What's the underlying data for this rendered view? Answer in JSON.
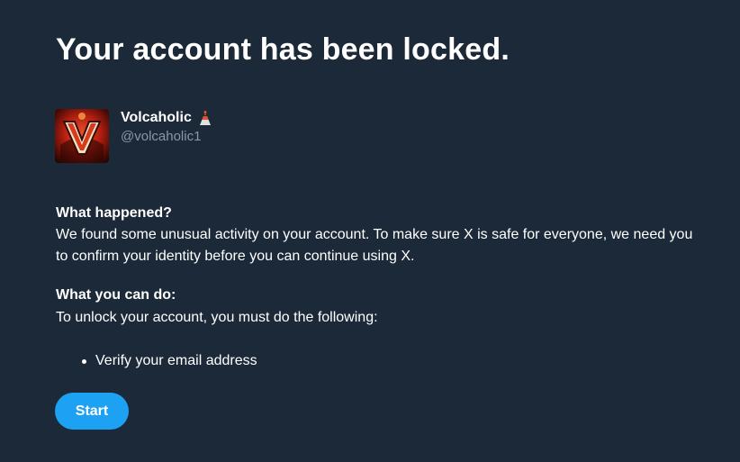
{
  "page": {
    "title": "Your account has been locked."
  },
  "profile": {
    "display_name": "Volcaholic",
    "name_emoji_icon": "volcano-icon",
    "handle": "@volcaholic1",
    "avatar_icon": "volcano-v-logo"
  },
  "what_happened": {
    "heading": "What happened?",
    "body": "We found some unusual activity on your account. To make sure X is safe for everyone, we need you to confirm your identity before you can continue using X."
  },
  "what_you_can_do": {
    "heading": "What you can do:",
    "body": "To unlock your account, you must do the following:",
    "steps": [
      "Verify your email address"
    ]
  },
  "actions": {
    "start_label": "Start"
  },
  "colors": {
    "background": "#1b2938",
    "primary_button": "#1da1f2",
    "secondary_text": "#8899a6"
  }
}
